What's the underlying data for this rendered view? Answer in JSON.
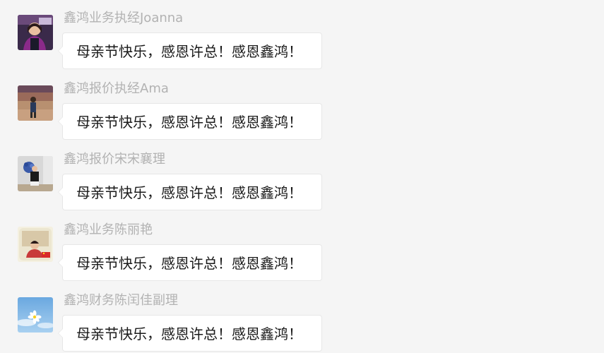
{
  "chat": {
    "messages": [
      {
        "sender": "鑫鸿业务执经Joanna",
        "text": "母亲节快乐，感恩许总！感恩鑫鸿！",
        "avatar": "person-purple-photo"
      },
      {
        "sender": "鑫鸿报价执经Ama",
        "text": "母亲节快乐，感恩许总！感恩鑫鸿！",
        "avatar": "child-outdoor-photo"
      },
      {
        "sender": "鑫鸿报价宋宋襄理",
        "text": "母亲节快乐，感恩许总！感恩鑫鸿！",
        "avatar": "person-flowers-photo"
      },
      {
        "sender": "鑫鸿业务陈丽艳",
        "text": "母亲节快乐，感恩许总！感恩鑫鸿！",
        "avatar": "person-flag-photo"
      },
      {
        "sender": "鑫鸿财务陈闰佳副理",
        "text": "母亲节快乐，感恩许总！感恩鑫鸿！",
        "avatar": "sky-flower-photo"
      }
    ]
  }
}
